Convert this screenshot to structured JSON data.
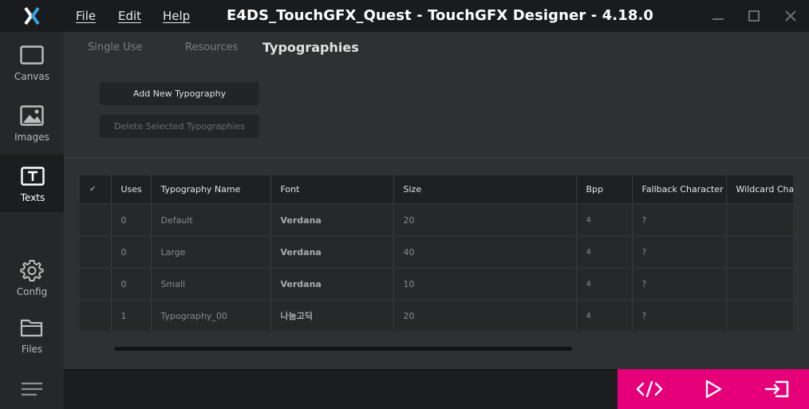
{
  "menu": {
    "file": "File",
    "edit": "Edit",
    "help": "Help"
  },
  "window_title": "E4DS_TouchGFX_Quest - TouchGFX Designer - 4.18.0",
  "sidebar": {
    "items": [
      {
        "label": "Canvas",
        "icon": "canvas-icon"
      },
      {
        "label": "Images",
        "icon": "image-icon"
      },
      {
        "label": "Texts",
        "icon": "text-icon",
        "active": true
      },
      {
        "label": "Config",
        "icon": "gear-icon"
      },
      {
        "label": "Files",
        "icon": "folder-icon"
      }
    ]
  },
  "tabs": [
    {
      "label": "Single Use"
    },
    {
      "label": "Resources"
    },
    {
      "label": "Typographies",
      "active": true
    }
  ],
  "buttons": {
    "add": "Add New Typography",
    "delete": "Delete Selected Typographies"
  },
  "table": {
    "headers": [
      "✔",
      "Uses",
      "Typography Name",
      "Font",
      "Size",
      "Bpp",
      "Fallback Character",
      "Wildcard Characters"
    ],
    "rows": [
      {
        "uses": "0",
        "name": "Default",
        "font": "Verdana",
        "size": "20",
        "bpp": "4",
        "fallback": "?",
        "wildcard": ""
      },
      {
        "uses": "0",
        "name": "Large",
        "font": "Verdana",
        "size": "40",
        "bpp": "4",
        "fallback": "?",
        "wildcard": ""
      },
      {
        "uses": "0",
        "name": "Small",
        "font": "Verdana",
        "size": "10",
        "bpp": "4",
        "fallback": "?",
        "wildcard": ""
      },
      {
        "uses": "1",
        "name": "Typography_00",
        "font": "나눔고딕",
        "size": "20",
        "bpp": "4",
        "fallback": "?",
        "wildcard": ""
      }
    ]
  },
  "colors": {
    "accent": "#e5007a",
    "logo_blue": "#3aa3e3",
    "background": "#2f3033"
  }
}
